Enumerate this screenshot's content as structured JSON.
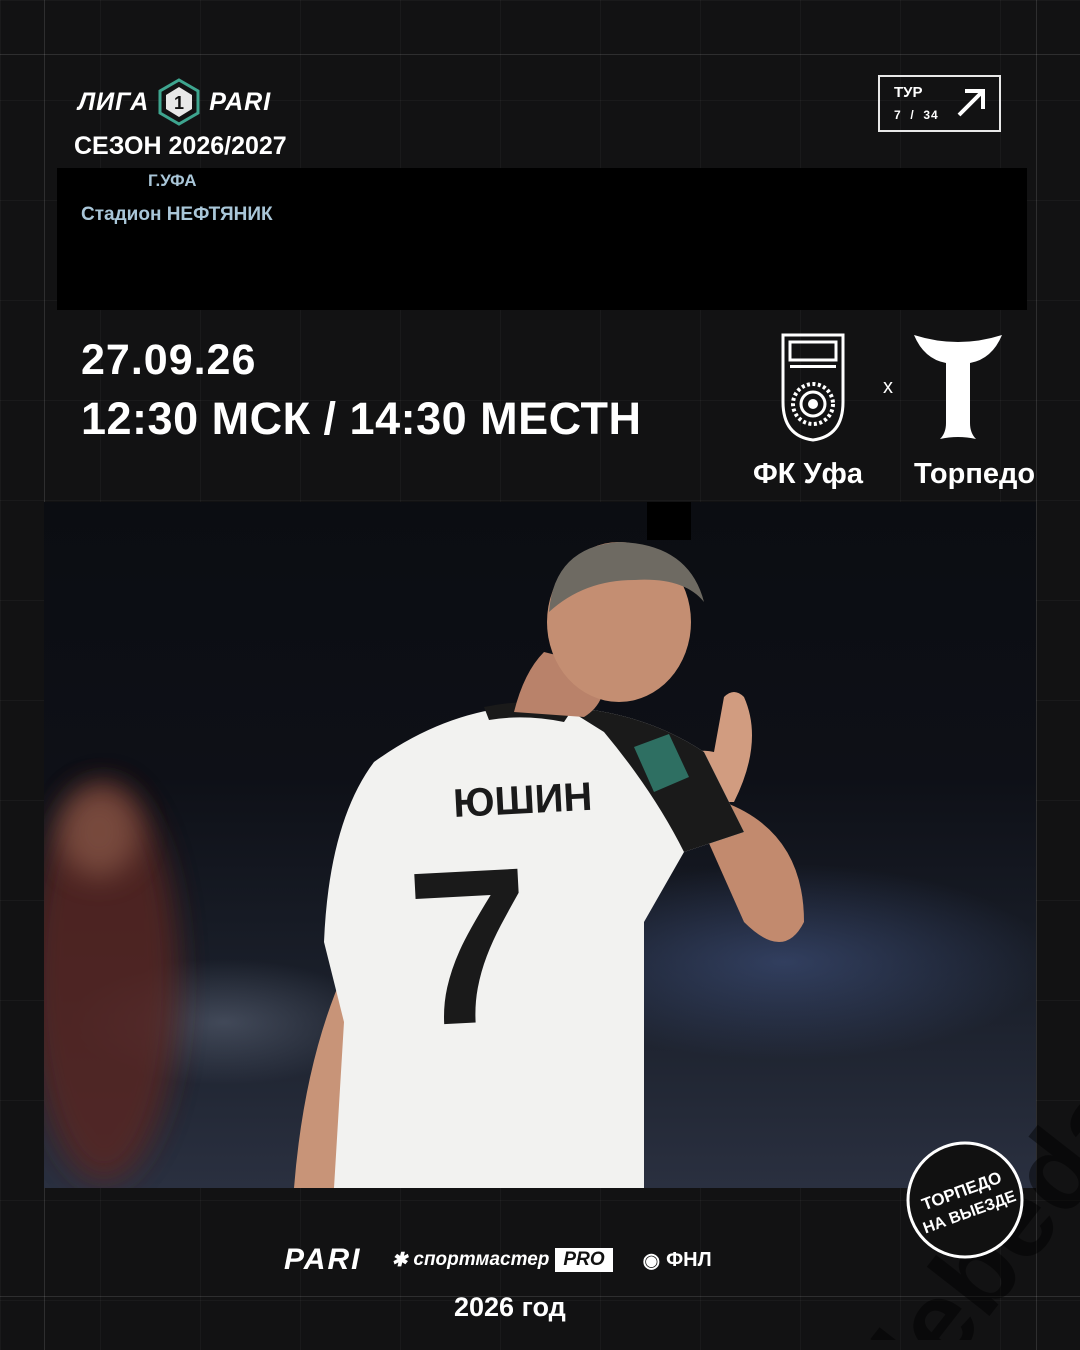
{
  "league": {
    "left_word": "ЛИГА",
    "badge_number": "1",
    "right_word": "PARI",
    "season": "СЕЗОН 2026/2027"
  },
  "venue": {
    "city": "Г.УФА",
    "stadium": "Стадион НЕФТЯНИК"
  },
  "round": {
    "label": "ТУР",
    "current": "7",
    "separator": "/",
    "total": "34"
  },
  "match": {
    "date": "27.09.26",
    "time": "12:30 МСК / 14:30 МЕСТН",
    "vs": "х",
    "home_team": "ФК Уфа",
    "away_team": "Торпедо"
  },
  "player": {
    "name_on_shirt": "ЮШИН",
    "number": "7"
  },
  "sponsors": {
    "pari": "PARI",
    "sportmaster": "спортмастер",
    "sportmaster_pro": "PRO",
    "fnl": "ФНЛ"
  },
  "stamp": {
    "line1": "ТОРПЕДО",
    "line2": "НА ВЫЕЗДЕ"
  },
  "watermark": "lebeda",
  "footer_year": "2026 год",
  "colors": {
    "background": "#121213",
    "accent_green": "#3ea58f",
    "venue_text": "#a9c6d8"
  }
}
